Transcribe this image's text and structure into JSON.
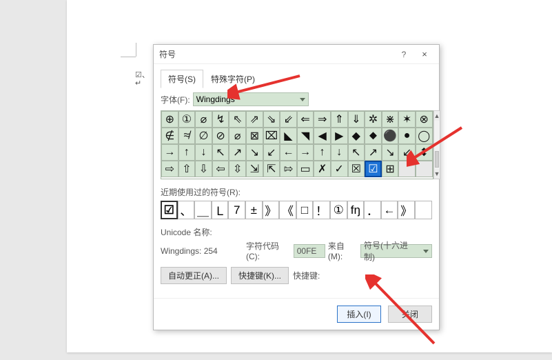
{
  "document": {
    "line1": "☑、",
    "line2": "↵"
  },
  "dialog": {
    "title": "符号",
    "help": "?",
    "close": "×",
    "tabs": {
      "symbols": "符号(S)",
      "special": "特殊字符(P)"
    },
    "font_label": "字体(F):",
    "font_value": "Wingdings",
    "grid": [
      "⊕",
      "①",
      "⌀",
      "↯",
      "⇖",
      "⇗",
      "⇘",
      "⇙",
      "⇐",
      "⇒",
      "⇑",
      "⇓",
      "✲",
      "⋇",
      "✶",
      "⊗",
      "∉",
      "≉",
      "∅",
      "⊘",
      "⌀",
      "⊠",
      "⌧",
      "◣",
      "◥",
      "◀",
      "▶",
      "◆",
      "⬥",
      "⚫",
      "●",
      "◯",
      "→",
      "↑",
      "↓",
      "↖",
      "↗",
      "↘",
      "↙",
      "←",
      "→",
      "↑",
      "↓",
      "↖",
      "↗",
      "↘",
      "↙",
      "⬍",
      "⇨",
      "⇧",
      "⇩",
      "⇦",
      "⇳",
      "⇲",
      "⇱",
      "⇰",
      "▭",
      "✗",
      "✓",
      "☒",
      "☑",
      "⊞"
    ],
    "selected_index": 60,
    "recent_label": "近期使用过的符号(R):",
    "recent": [
      "☑",
      "、",
      "＿",
      "Ｌ",
      "7",
      "±",
      "》",
      "《",
      "□",
      "！",
      "①",
      "fŋ",
      "．",
      "←",
      "》"
    ],
    "unicode_name_label": "Unicode 名称:",
    "unicode_name_value": "Wingdings: 254",
    "char_code_label": "字符代码(C):",
    "char_code_value": "00FE",
    "from_label": "来自(M):",
    "from_value": "符号(十六进制)",
    "autocorrect": "自动更正(A)...",
    "shortcut": "快捷键(K)...",
    "shortcut_label": "快捷键:",
    "insert": "插入(I)",
    "close_btn": "关闭"
  },
  "annotations": {
    "arrow_color": "#e5322e"
  }
}
